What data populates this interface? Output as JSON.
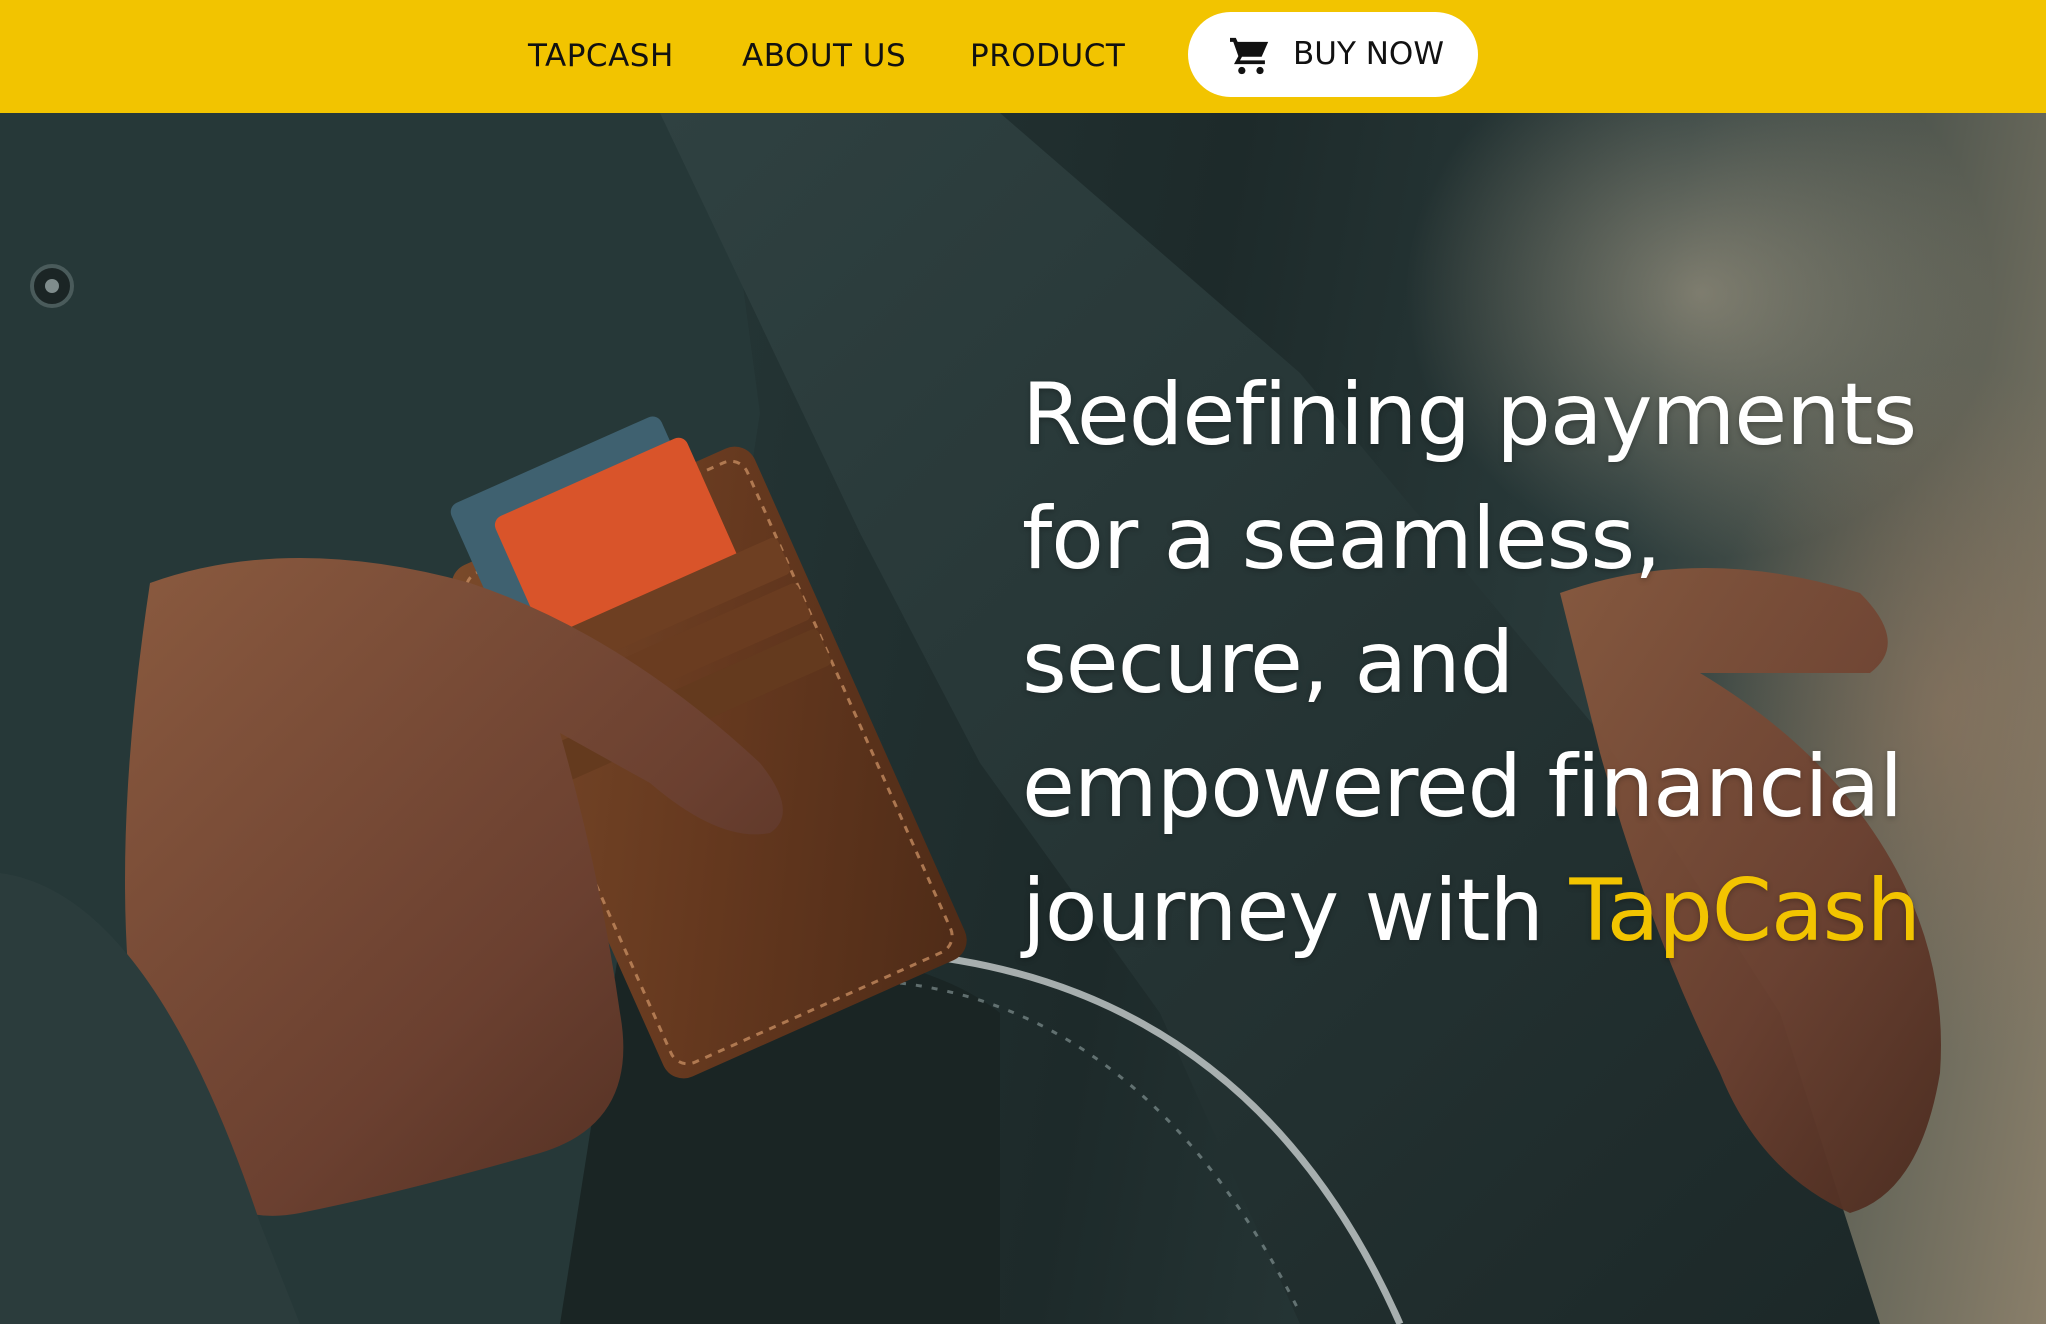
{
  "nav": {
    "items": [
      {
        "label": "TAPCASH"
      },
      {
        "label": "ABOUT US"
      },
      {
        "label": "PRODUCT"
      }
    ],
    "buy_button": {
      "label": "BUY NOW",
      "icon": "shopping-cart-icon"
    }
  },
  "hero": {
    "headline_lines": [
      "Redefining payments",
      "for a seamless,",
      "secure, and",
      "empowered financial"
    ],
    "headline_last_prefix": "journey with ",
    "headline_brand": "TapCash",
    "image": "man placing leather wallet with cards into suit jacket inner pocket"
  },
  "colors": {
    "brand_yellow": "#f2c400",
    "headline_text": "#ffffff",
    "nav_text": "#111111"
  }
}
